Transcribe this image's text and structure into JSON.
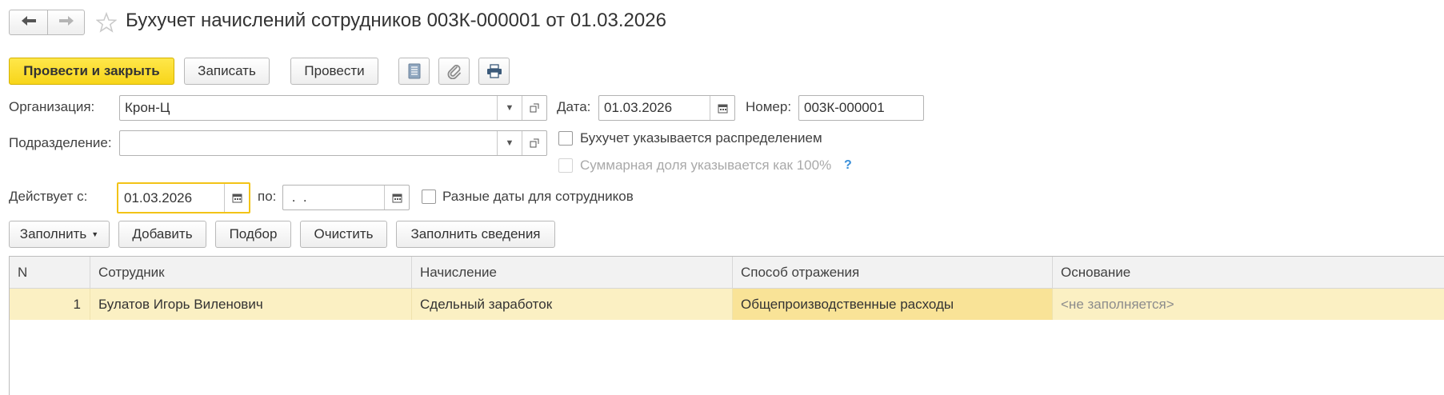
{
  "window": {
    "title": "Бухучет начислений сотрудников 003К-000001 от 01.03.2026"
  },
  "nav": {
    "back_icon": "arrow-left-icon",
    "forward_icon": "arrow-right-icon",
    "favorite_icon": "star-icon"
  },
  "toolbar": {
    "post_close_label": "Провести и закрыть",
    "save_label": "Записать",
    "post_label": "Провести",
    "icons": [
      "document-list-icon",
      "paperclip-icon",
      "printer-icon"
    ]
  },
  "form": {
    "organization_label": "Организация:",
    "organization_value": "Крон-Ц",
    "date_label": "Дата:",
    "date_value": "01.03.2026",
    "number_label": "Номер:",
    "number_value": "003К-000001",
    "department_label": "Подразделение:",
    "department_value": "",
    "distribution_label": "Бухучет указывается распределением",
    "total_share_label": "Суммарная доля указывается как 100%",
    "help_label": "?",
    "valid_from_label": "Действует с:",
    "valid_from_value": "01.03.2026",
    "to_label": "по:",
    "to_value": " .  .",
    "different_dates_label": "Разные даты для сотрудников"
  },
  "table_toolbar": {
    "fill_label": "Заполнить",
    "add_label": "Добавить",
    "pick_label": "Подбор",
    "clear_label": "Очистить",
    "fill_info_label": "Заполнить сведения"
  },
  "table": {
    "columns": [
      "N",
      "Сотрудник",
      "Начисление",
      "Способ отражения",
      "Основание"
    ],
    "rows": [
      {
        "n": "1",
        "employee": "Булатов Игорь Виленович",
        "accrual": "Сдельный заработок",
        "method": "Общепроизводственные расходы",
        "basis": "<не заполняется>"
      }
    ]
  },
  "colors": {
    "primary_button": "#f7d51a",
    "focus_border": "#f2c317",
    "selected_row": "#fbf0c3",
    "selected_cell": "#f9e397",
    "help": "#3a8fd9"
  }
}
